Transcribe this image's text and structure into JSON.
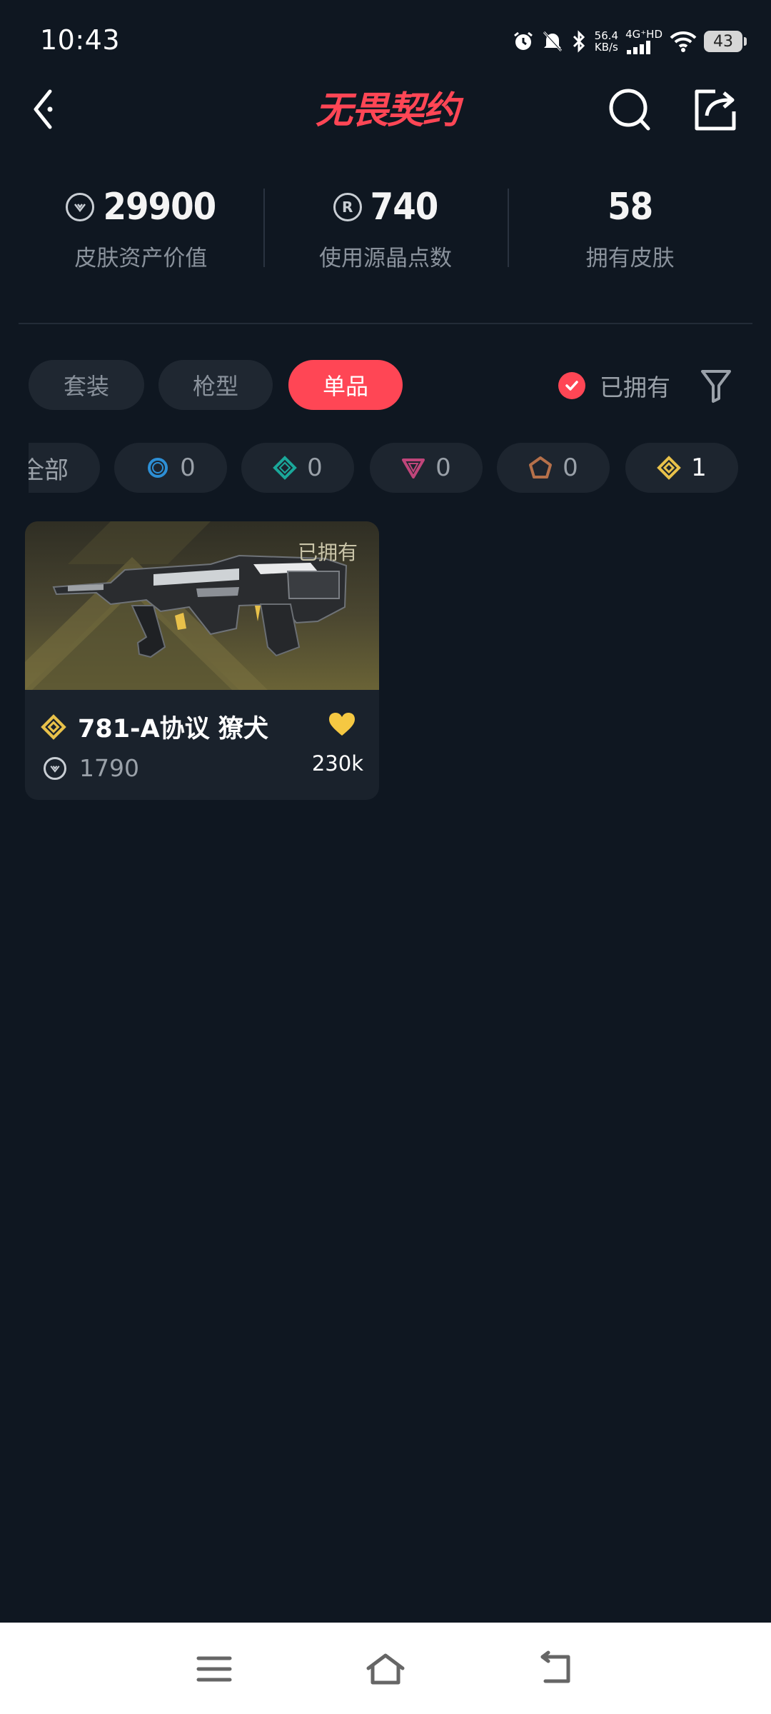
{
  "status_bar": {
    "time": "10:43",
    "net_speed_value": "56.4",
    "net_speed_unit": "KB/s",
    "net_type": "4G⁺HD",
    "battery": "43",
    "icons": [
      "alarm-icon",
      "mute-icon",
      "bluetooth-icon",
      "signal-icon",
      "wifi-icon",
      "battery-icon"
    ]
  },
  "header": {
    "logo_text": "无畏契约",
    "icons": [
      "back-icon",
      "search-icon",
      "share-icon"
    ]
  },
  "stats": [
    {
      "value": "29900",
      "label": "皮肤资产价值",
      "icon": "vp-coin-icon"
    },
    {
      "value": "740",
      "label": "使用源晶点数",
      "icon": "radianite-icon"
    },
    {
      "value": "58",
      "label": "拥有皮肤",
      "icon": ""
    }
  ],
  "tabs": [
    {
      "label": "套装",
      "active": false
    },
    {
      "label": "枪型",
      "active": false
    },
    {
      "label": "单品",
      "active": true
    }
  ],
  "owned_filter": {
    "label": "已拥有",
    "checked": true
  },
  "rarity_chips": [
    {
      "label": "全部",
      "count": ""
    },
    {
      "icon": "select-tier-icon",
      "count": "0",
      "color": "#2d8fd5"
    },
    {
      "icon": "deluxe-tier-icon",
      "count": "0",
      "color": "#1aa89a"
    },
    {
      "icon": "premium-tier-icon",
      "count": "0",
      "color": "#c0457a"
    },
    {
      "icon": "ultra-tier-icon",
      "count": "0",
      "color": "#b5704a"
    },
    {
      "icon": "exclusive-tier-icon",
      "count": "1",
      "color": "#e8c14a"
    }
  ],
  "skins": [
    {
      "owned_badge": "已拥有",
      "name": "781-A协议 獠犬",
      "price": "1790",
      "likes": "230k",
      "tier_color": "#e8c14a"
    }
  ],
  "colors": {
    "accent": "#ff4655",
    "background": "#0f1721",
    "chip_bg": "#1d252f",
    "gold": "#e8c14a"
  }
}
